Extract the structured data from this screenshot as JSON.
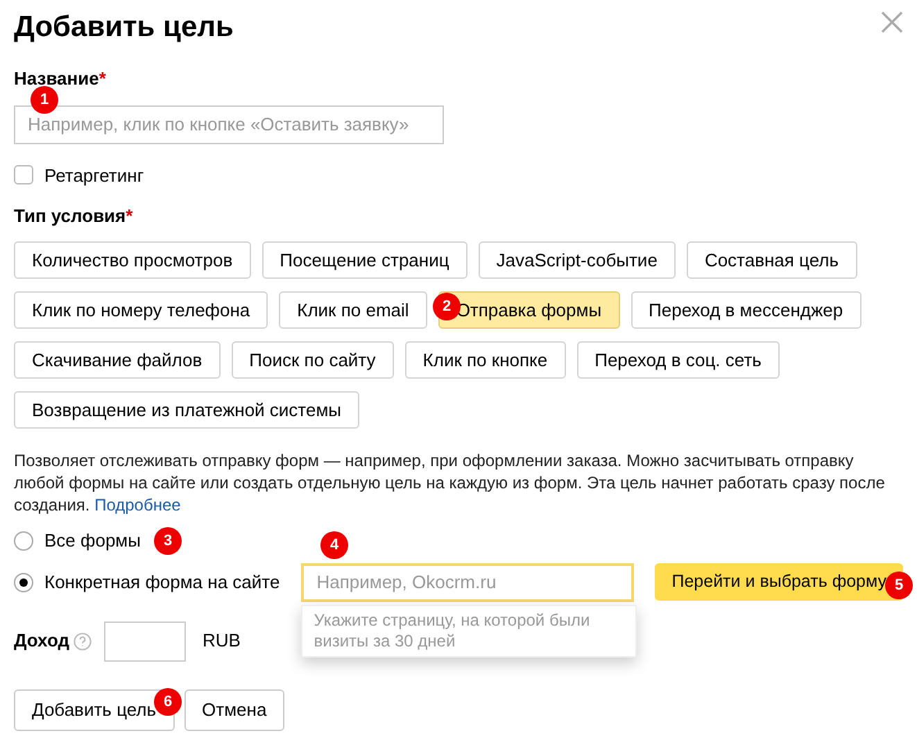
{
  "dialog": {
    "title": "Добавить цель"
  },
  "name_field": {
    "label": "Название",
    "required_mark": "*",
    "placeholder": "Например, клик по кнопке «Оставить заявку»"
  },
  "retargeting": {
    "label": "Ретаргетинг",
    "checked": false
  },
  "condition_type": {
    "label": "Тип условия",
    "required_mark": "*",
    "options": [
      {
        "label": "Количество просмотров",
        "selected": false
      },
      {
        "label": "Посещение страниц",
        "selected": false
      },
      {
        "label": "JavaScript-событие",
        "selected": false
      },
      {
        "label": "Составная цель",
        "selected": false
      },
      {
        "label": "Клик по номеру телефона",
        "selected": false
      },
      {
        "label": "Клик по email",
        "selected": false
      },
      {
        "label": "Отправка формы",
        "selected": true
      },
      {
        "label": "Переход в мессенджер",
        "selected": false
      },
      {
        "label": "Скачивание файлов",
        "selected": false
      },
      {
        "label": "Поиск по сайту",
        "selected": false
      },
      {
        "label": "Клик по кнопке",
        "selected": false
      },
      {
        "label": "Переход в соц. сеть",
        "selected": false
      },
      {
        "label": "Возвращение из платежной системы",
        "selected": false
      }
    ]
  },
  "description": {
    "text": "Позволяет отслеживать отправку форм — например, при оформлении заказа. Можно засчитывать отправку любой формы на сайте или создать отдельную цель на каждую из форм. Эта цель начнет работать сразу после создания.",
    "link": "Подробнее"
  },
  "form_scope": [
    {
      "label": "Все формы",
      "selected": false
    },
    {
      "label": "Конкретная форма на сайте",
      "selected": true
    }
  ],
  "page_field": {
    "placeholder": "Например, Okocrm.ru",
    "hint": "Укажите страницу, на которой были визиты за 30 дней"
  },
  "select_button": "Перейти и выбрать форму",
  "income": {
    "label": "Доход",
    "currency": "RUB"
  },
  "buttons": [
    "Добавить цель",
    "Отмена"
  ],
  "markers": [
    "1",
    "2",
    "3",
    "4",
    "5",
    "6"
  ]
}
